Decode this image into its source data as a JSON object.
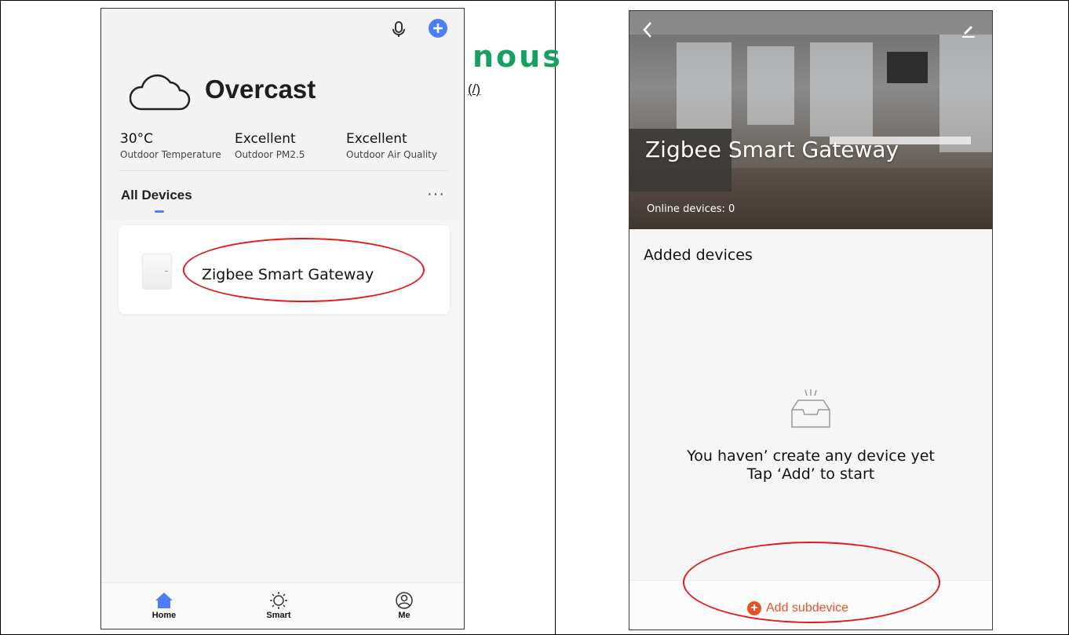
{
  "left_screen": {
    "weather": {
      "condition": "Overcast",
      "stats": [
        {
          "value": "30°C",
          "label": "Outdoor Temperature"
        },
        {
          "value": "Excellent",
          "label": "Outdoor PM2.5"
        },
        {
          "value": "Excellent",
          "label": "Outdoor Air Quality"
        }
      ]
    },
    "section_title": "All Devices",
    "more_label": "···",
    "device_name": "Zigbee Smart Gateway",
    "tabs": [
      {
        "label": "Home",
        "icon": "home-icon",
        "color": "#4d7ef7"
      },
      {
        "label": "Smart",
        "icon": "sun-icon"
      },
      {
        "label": "Me",
        "icon": "profile-icon"
      }
    ]
  },
  "logo": {
    "text": "nous",
    "link": "(/)",
    "color": "#17a062"
  },
  "right_screen": {
    "title": "Zigbee Smart Gateway",
    "online_devices": "Online devices: 0",
    "section_title": "Added devices",
    "empty_line1": "You haven’ create any device yet",
    "empty_line2": "Tap ‘Add’ to start",
    "add_button": "Add subdevice",
    "accent": "#e2552a"
  },
  "annotation_color": "#e01b1b"
}
